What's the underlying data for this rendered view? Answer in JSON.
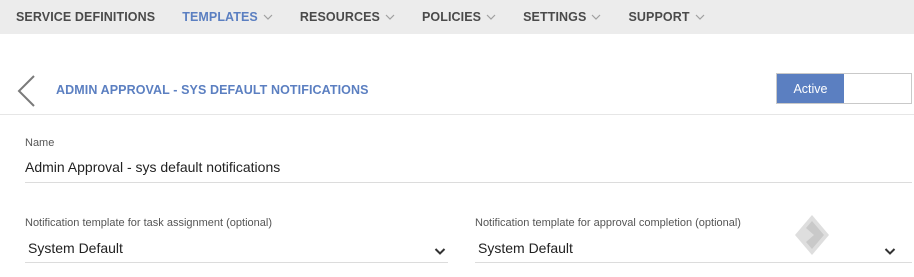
{
  "nav": {
    "items": [
      {
        "label": "SERVICE DEFINITIONS",
        "has_dropdown": false,
        "active": false
      },
      {
        "label": "TEMPLATES",
        "has_dropdown": true,
        "active": true
      },
      {
        "label": "RESOURCES",
        "has_dropdown": true,
        "active": false
      },
      {
        "label": "POLICIES",
        "has_dropdown": true,
        "active": false
      },
      {
        "label": "SETTINGS",
        "has_dropdown": true,
        "active": false
      },
      {
        "label": "SUPPORT",
        "has_dropdown": true,
        "active": false
      }
    ]
  },
  "header": {
    "back_icon": "chevron-left-icon",
    "title": "ADMIN APPROVAL - SYS DEFAULT NOTIFICATIONS",
    "status_toggle": {
      "on_label": "Active",
      "state": "on"
    }
  },
  "form": {
    "name": {
      "label": "Name",
      "value": "Admin Approval - sys default notifications"
    },
    "task_assignment": {
      "label": "Notification template for task assignment (optional)",
      "value": "System Default"
    },
    "approval_completion": {
      "label": "Notification template for approval completion (optional)",
      "value": "System Default"
    }
  },
  "colors": {
    "accent": "#5b7fc1",
    "nav_background": "#ececec",
    "nav_text": "#4a4a4a"
  }
}
